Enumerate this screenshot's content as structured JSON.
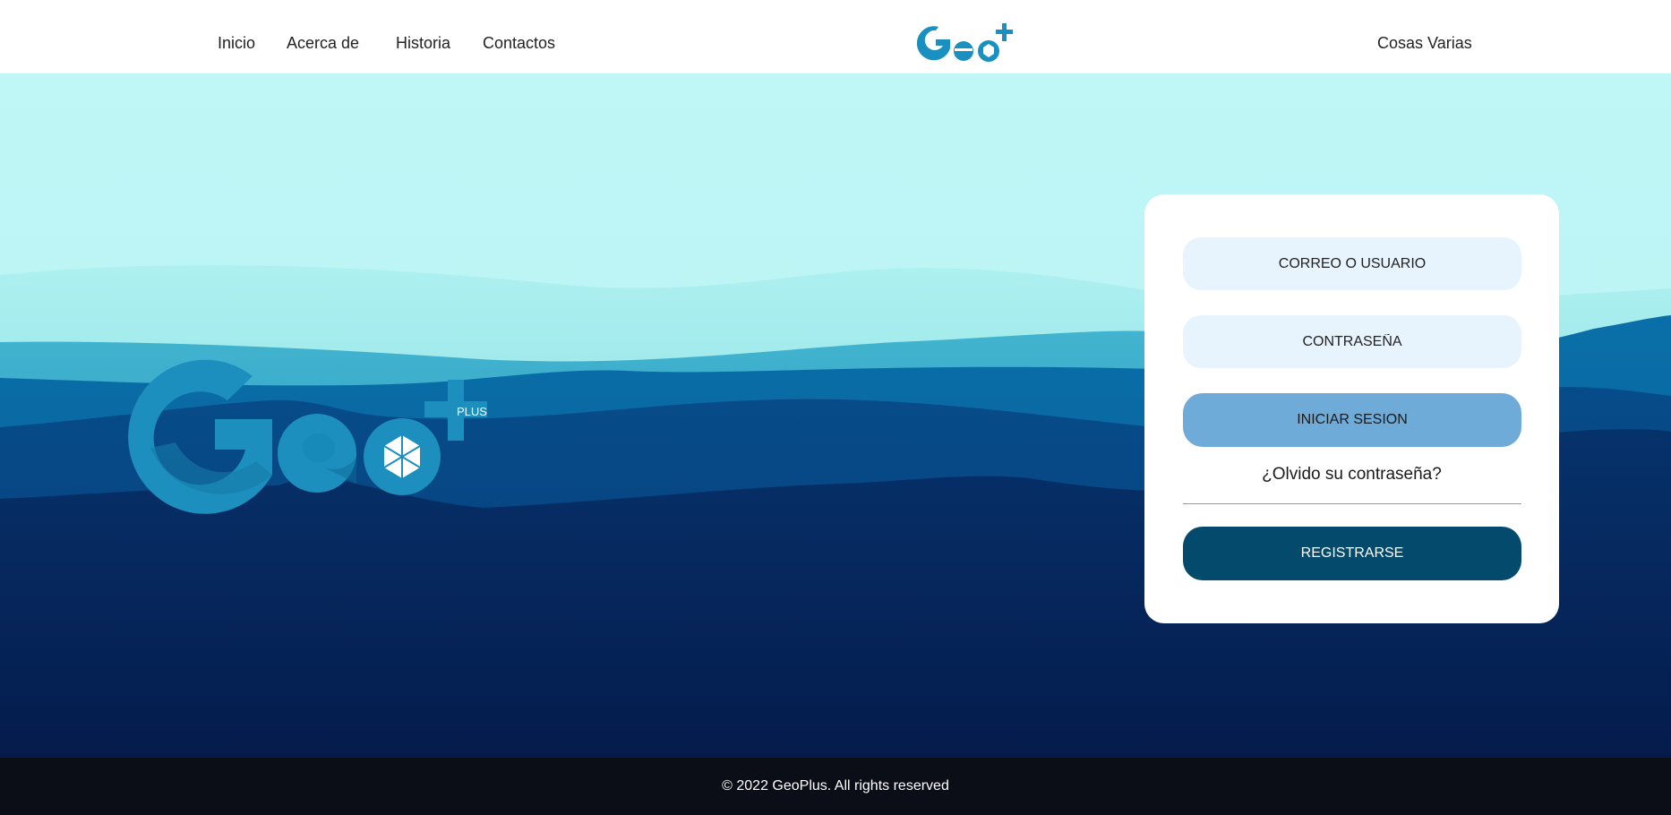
{
  "nav": {
    "links": [
      "Inicio",
      "Acerca de",
      "Historia",
      "Contactos"
    ],
    "right_link": "Cosas Varias",
    "logo_icon": "geoplus-logo"
  },
  "hero": {
    "logo_icon": "geoplus-logo",
    "logo_plus_text": "PLUS"
  },
  "login": {
    "user_placeholder": "CORREO O USUARIO",
    "password_placeholder": "CONTRASEÑA",
    "login_button": "INICIAR SESION",
    "forgot_link": "¿Olvido su contraseña?",
    "register_button": "REGISTRARSE"
  },
  "footer": {
    "copyright": "© 2022 GeoPlus. All rights reserved"
  },
  "colors": {
    "brand": "#1a90c0",
    "field_bg": "#e8f4fd",
    "login_btn": "#6fabd8",
    "register_btn": "#034a6d",
    "footer_bg": "#0c0e17",
    "sky": "#bff6f6"
  }
}
